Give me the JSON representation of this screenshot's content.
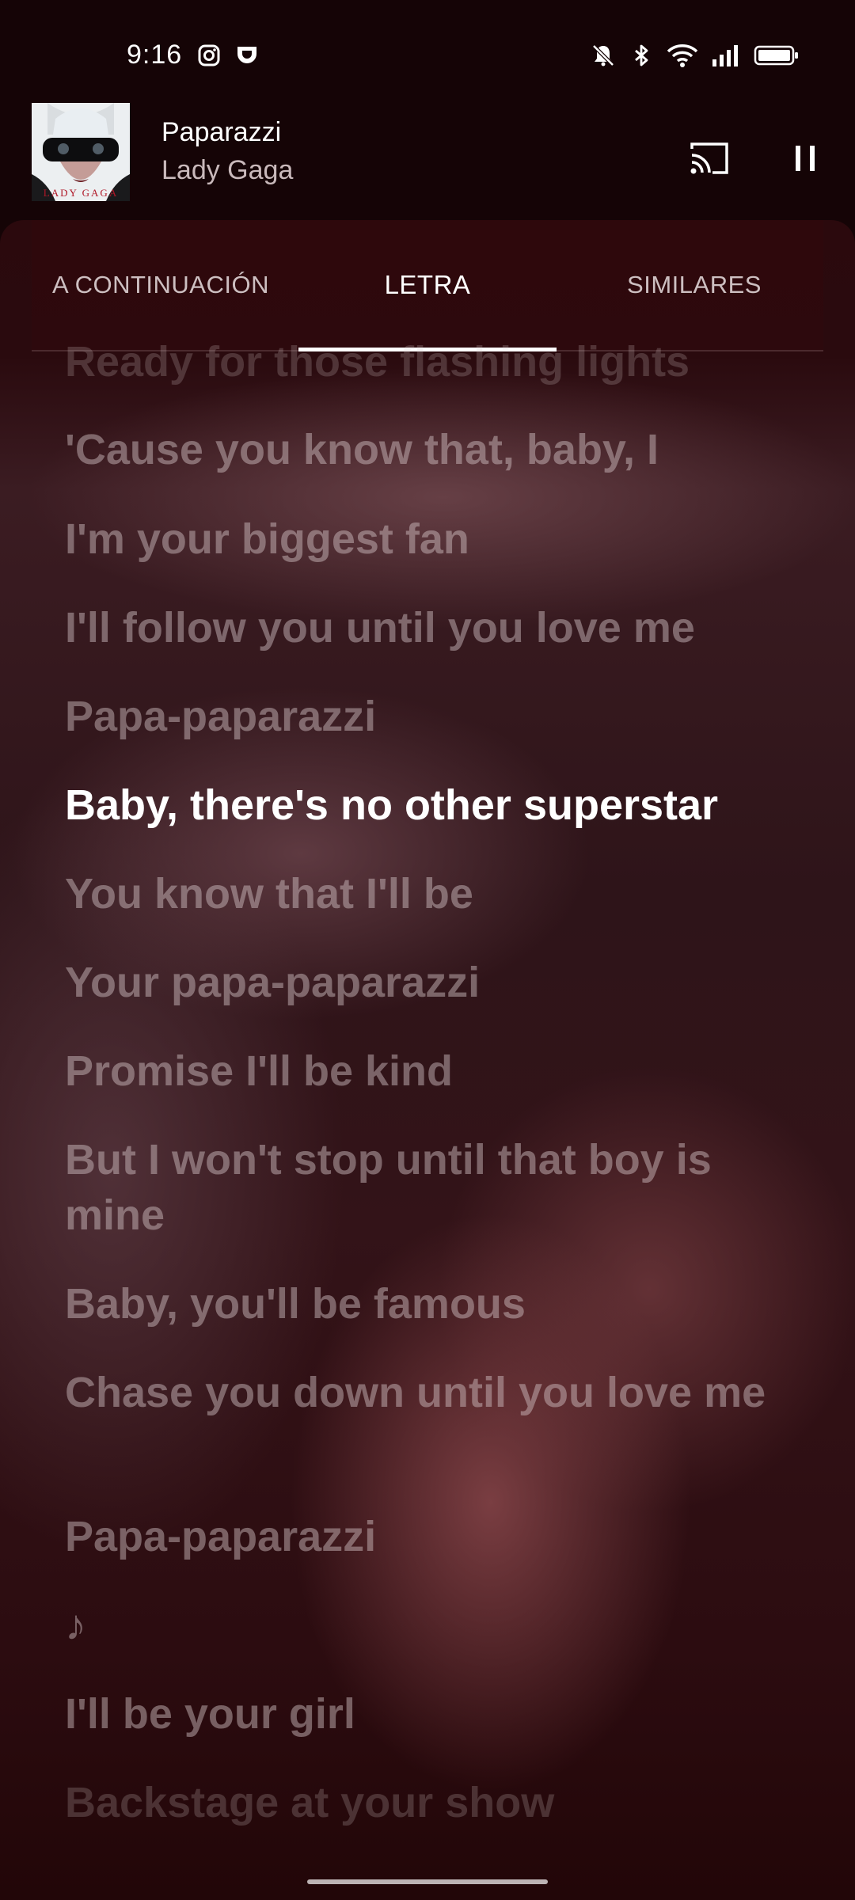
{
  "status_bar": {
    "time": "9:16",
    "left_icons": [
      "instagram-icon",
      "app-notification-icon"
    ],
    "right_icons": [
      "mute-bell-icon",
      "bluetooth-icon",
      "wifi-icon",
      "signal-icon",
      "battery-icon"
    ]
  },
  "mini_player": {
    "album_art_text": "LADY GAGA",
    "title": "Paparazzi",
    "artist": "Lady Gaga"
  },
  "tabs": [
    {
      "label": "A CONTINUACIÓN",
      "active": false
    },
    {
      "label": "LETRA",
      "active": true
    },
    {
      "label": "SIMILARES",
      "active": false
    }
  ],
  "lyrics": [
    "Ready for those flashing lights",
    "'Cause you know that, baby, I",
    "I'm your biggest fan",
    "I'll follow you until you love me",
    "Papa-paparazzi",
    "Baby, there's no other superstar",
    "You know that I'll be",
    "Your papa-paparazzi",
    "Promise I'll be kind",
    "But I won't stop until that boy is mine",
    "Baby, you'll be famous",
    "Chase you down until you love me",
    "Papa-paparazzi",
    "♪",
    "I'll be your girl",
    "Backstage at your show"
  ],
  "current_lyric_index": 5
}
